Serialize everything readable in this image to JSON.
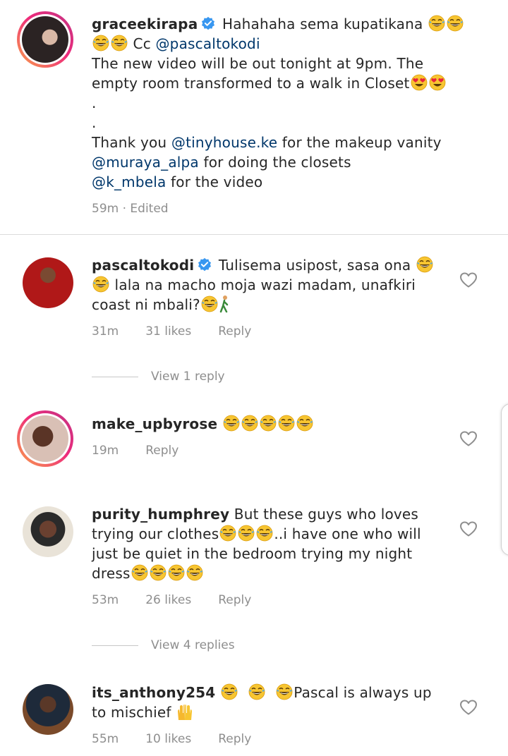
{
  "caption": {
    "username": "graceekirapa",
    "lines": [
      {
        "parts": [
          {
            "t": "Hahahaha sema kupatikana ",
            "m": false
          }
        ],
        "emojis_after": 2
      },
      {
        "parts": [
          {
            "t": " Cc ",
            "m": false
          },
          {
            "t": "@pascaltokodi",
            "m": true
          }
        ],
        "emojis_before": 2
      },
      {
        "parts": [
          {
            "t": "The new video will be out tonight at 9pm. The",
            "m": false
          }
        ]
      },
      {
        "parts": [
          {
            "t": "empty room transformed to a walk in Closet",
            "m": false
          }
        ],
        "hearts_after": 2
      },
      {
        "parts": [
          {
            "t": ".",
            "m": false
          }
        ]
      },
      {
        "parts": [
          {
            "t": ".",
            "m": false
          }
        ]
      },
      {
        "parts": [
          {
            "t": "Thank you ",
            "m": false
          },
          {
            "t": "@tinyhouse.ke",
            "m": true
          },
          {
            "t": " for the makeup vanity",
            "m": false
          }
        ]
      },
      {
        "parts": [
          {
            "t": "@muraya_alpa",
            "m": true
          },
          {
            "t": " for doing the closets",
            "m": false
          }
        ]
      },
      {
        "parts": [
          {
            "t": "@k_mbela",
            "m": true
          },
          {
            "t": " for the video",
            "m": false
          }
        ]
      }
    ],
    "time": "59m",
    "edited": "Edited"
  },
  "comments": [
    {
      "username": "pascaltokodi",
      "verified": true,
      "text1": "Tulisema usipost, sasa ona ",
      "text2": " lala na macho moja wazi madam, unafkiri",
      "text3": "coast ni mbali?",
      "time": "31m",
      "likes": "31 likes",
      "reply": "Reply",
      "view_replies": "View 1 reply"
    },
    {
      "username": "make_upbyrose",
      "time": "19m",
      "reply": "Reply"
    },
    {
      "username": "purity_humphrey",
      "text1": "But these guys who loves",
      "text2": "trying our clothes",
      "text2b": "..i have one who will",
      "text3": "just be quiet in the bedroom trying my night",
      "text4": "dress",
      "time": "53m",
      "likes": "26 likes",
      "reply": "Reply",
      "view_replies": "View 4 replies"
    },
    {
      "username": "its_anthony254",
      "text1": "Pascal is always up",
      "text2": "to mischief ",
      "time": "55m",
      "likes": "10 likes",
      "reply": "Reply"
    }
  ],
  "icons": {
    "heart": "heart-outline-icon",
    "verified": "verified-badge-icon",
    "laugh": "tears-of-joy-emoji",
    "heart_eyes": "heart-eyes-emoji",
    "walker": "person-walking-emoji",
    "raised_hands": "raised-hands-emoji"
  },
  "colors": {
    "mention": "#00376b",
    "verified": "#3897f0",
    "meta": "#8e8e8e"
  }
}
